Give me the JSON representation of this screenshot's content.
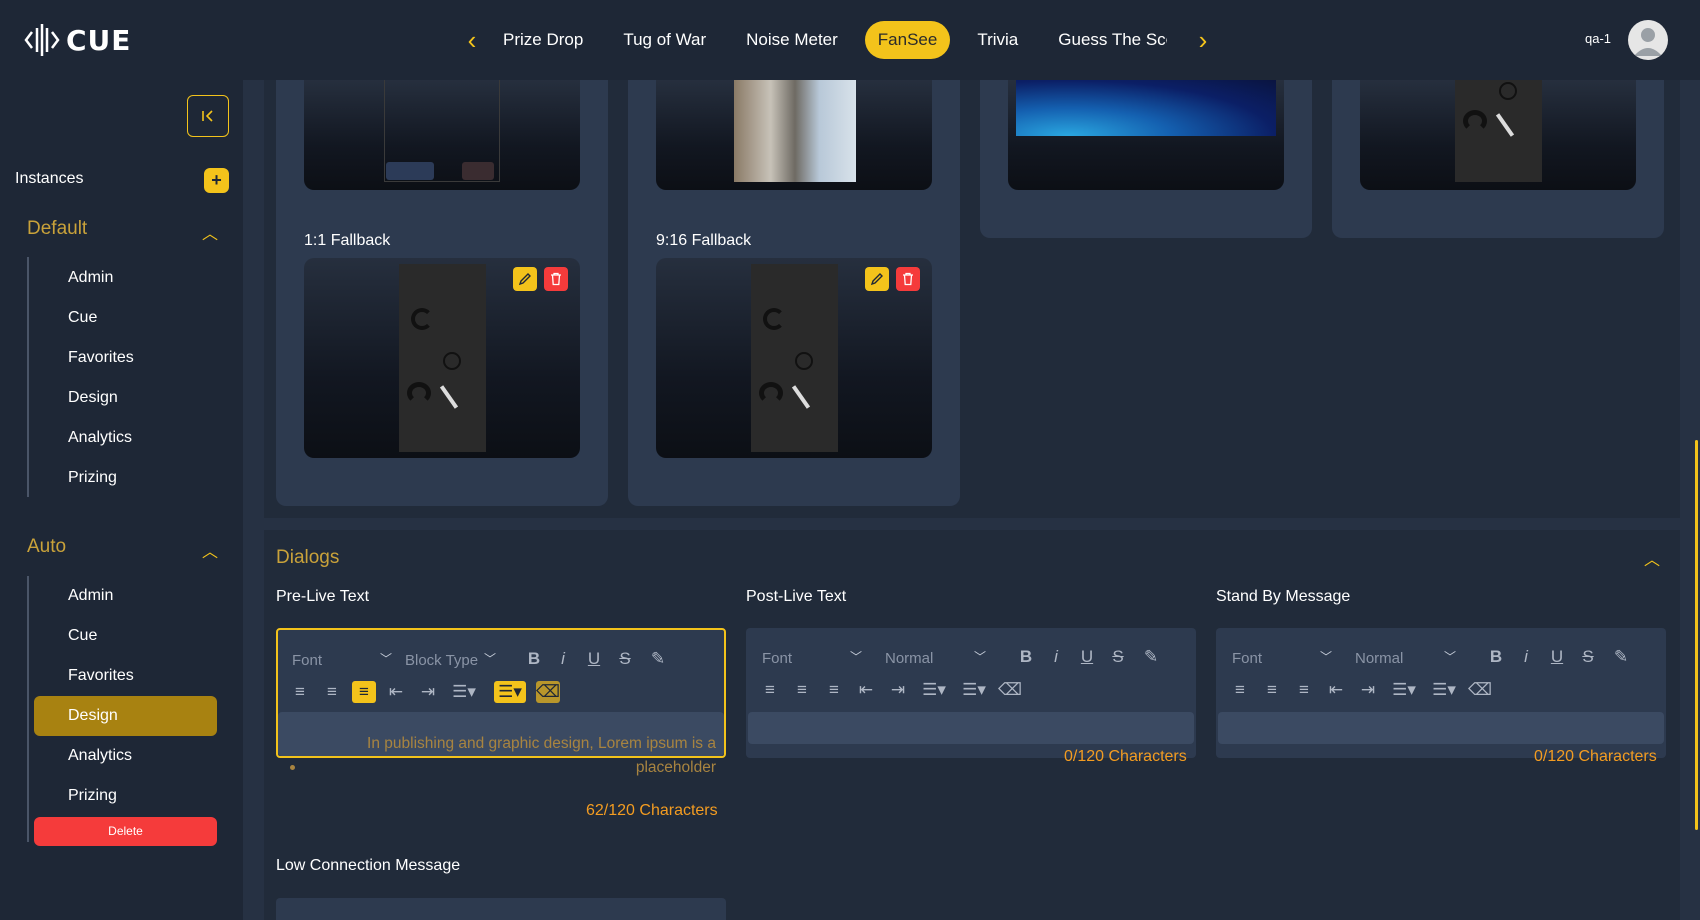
{
  "app": {
    "logo_text": "CUE"
  },
  "topbar": {
    "tabs": [
      {
        "label": "Prize Drop",
        "active": false
      },
      {
        "label": "Tug of War",
        "active": false
      },
      {
        "label": "Noise Meter",
        "active": false
      },
      {
        "label": "FanSee",
        "active": true
      },
      {
        "label": "Trivia",
        "active": false
      },
      {
        "label": "Guess The Score",
        "active": false
      }
    ],
    "user_name": "qa-1"
  },
  "sidebar": {
    "instances_label": "Instances",
    "add_button": "+",
    "groups": [
      {
        "title": "Default",
        "items": [
          "Admin",
          "Cue",
          "Favorites",
          "Design",
          "Analytics",
          "Prizing"
        ]
      },
      {
        "title": "Auto",
        "items": [
          "Admin",
          "Cue",
          "Favorites",
          "Design",
          "Analytics",
          "Prizing"
        ],
        "active_item": "Design"
      }
    ],
    "delete_label": "Delete"
  },
  "media": {
    "fallback_1_1": "1:1 Fallback",
    "fallback_9_16": "9:16 Fallback"
  },
  "dialogs": {
    "title": "Dialogs",
    "editors": [
      {
        "label": "Pre-Live Text",
        "font": "Font",
        "block": "Block Type",
        "text": "In publishing and graphic design, Lorem ipsum is a placeholder",
        "count": "62/120 Characters"
      },
      {
        "label": "Post-Live Text",
        "font": "Font",
        "block": "Normal",
        "text": "",
        "count": "0/120 Characters"
      },
      {
        "label": "Stand By Message",
        "font": "Font",
        "block": "Normal",
        "text": "",
        "count": "0/120 Characters"
      }
    ],
    "low_connection_label": "Low Connection Message"
  },
  "colors": {
    "accent": "#f3c31b",
    "danger": "#f53b3b",
    "active_menu": "#a88211",
    "counter": "#f39c21"
  }
}
